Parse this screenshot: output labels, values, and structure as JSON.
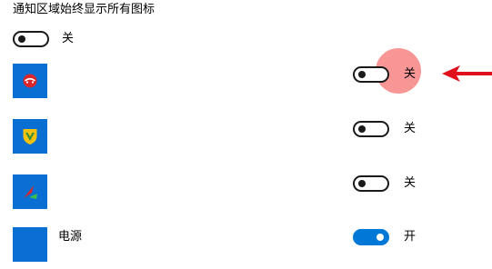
{
  "header": {
    "title": "通知区域始终显示所有图标"
  },
  "master_toggle": {
    "state_label": "关",
    "is_on": false
  },
  "apps": [
    {
      "name": "",
      "icon": "red-app-tray-icon",
      "state_label": "关",
      "is_on": false
    },
    {
      "name": "",
      "icon": "yellow-shield-icon",
      "state_label": "关",
      "is_on": false
    },
    {
      "name": "",
      "icon": "red-green-arrow-logo-icon",
      "state_label": "关",
      "is_on": false
    },
    {
      "name": "电源",
      "icon": "power-icon",
      "state_label": "开",
      "is_on": true
    }
  ],
  "annotation": {
    "highlight": "highlight-circle",
    "pointer": "red-arrow-icon"
  },
  "colors": {
    "toggle_on": "#0078d7",
    "toggle_off_border": "#1a1a1a",
    "app_icon_bg": "#0a6fd2",
    "highlight": "#f45555",
    "arrow": "#e0101c"
  }
}
